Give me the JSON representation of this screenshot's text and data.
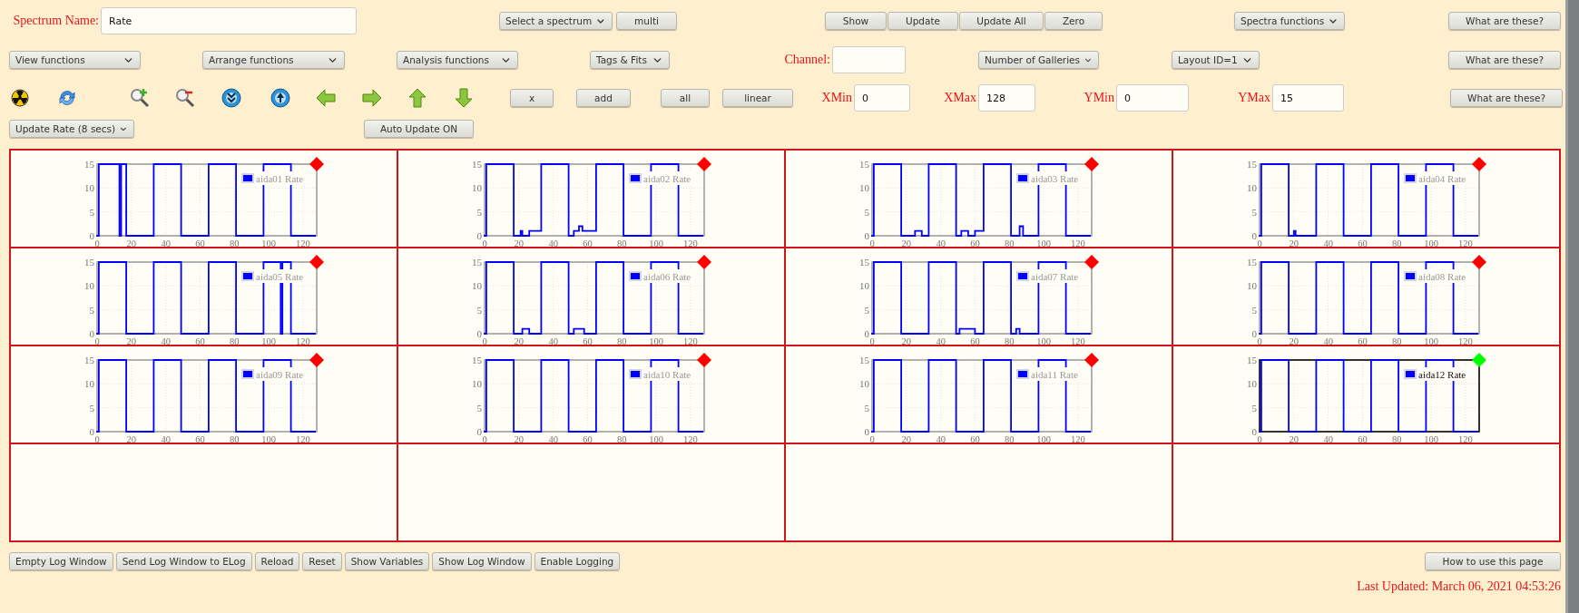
{
  "toolbar_rows": [
    {
      "items": [
        {
          "kind": "field",
          "label": "Spectrum Name:",
          "value": "Rate"
        },
        {
          "kind": "dropdown",
          "label": "Select a spectrum"
        },
        {
          "kind": "button",
          "label": "multi"
        },
        {
          "kind": "button",
          "label": "Show"
        },
        {
          "kind": "button",
          "label": "Update"
        },
        {
          "kind": "button",
          "label": "Update All"
        },
        {
          "kind": "button",
          "label": "Zero"
        },
        {
          "kind": "dropdown",
          "label": "Spectra functions"
        },
        {
          "kind": "button",
          "label": "What are these?"
        }
      ]
    },
    {
      "items": [
        {
          "kind": "dropdown",
          "label": "View functions"
        },
        {
          "kind": "dropdown",
          "label": "Arrange functions"
        },
        {
          "kind": "dropdown",
          "label": "Analysis functions"
        },
        {
          "kind": "dropdown",
          "label": "Tags & Fits"
        },
        {
          "kind": "field",
          "label": "Channel:"
        },
        {
          "kind": "dropdown",
          "label": "Number of Galleries"
        },
        {
          "kind": "dropdown",
          "label": "Layout ID=1"
        },
        {
          "kind": "button",
          "label": "What are these?"
        }
      ]
    },
    {
      "items": [
        {
          "kind": "button",
          "label": "x"
        },
        {
          "kind": "button",
          "label": "add"
        },
        {
          "kind": "button",
          "label": "all"
        },
        {
          "kind": "button",
          "label": "linear"
        },
        {
          "kind": "field",
          "label": "XMin",
          "value": "0"
        },
        {
          "kind": "field",
          "label": "XMax",
          "value": "128"
        },
        {
          "kind": "field",
          "label": "YMin",
          "value": "0"
        },
        {
          "kind": "field",
          "label": "YMax",
          "value": "15"
        },
        {
          "kind": "button",
          "label": "What are these?"
        }
      ]
    },
    {
      "items": [
        {
          "kind": "dropdown",
          "label": "Update Rate (8 secs)"
        },
        {
          "kind": "button",
          "label": "Auto Update ON"
        }
      ]
    }
  ],
  "gallery": {
    "cells": [
      {
        "kind": "chart",
        "selected": false,
        "color": "#ff0000",
        "chart_data": {
          "type": "line",
          "grid": true,
          "x": [
            0,
            1,
            1,
            13,
            13,
            14,
            14,
            17,
            17,
            33,
            33,
            49,
            49,
            65,
            65,
            81,
            81,
            97,
            97,
            113,
            113,
            127
          ],
          "xlim": [
            0,
            128
          ],
          "ylim": [
            0,
            15
          ],
          "xticks": [
            0,
            20,
            40,
            60,
            80,
            100,
            120
          ],
          "yticks": [
            0,
            5,
            10,
            15
          ],
          "series": [
            {
              "name": "aida01 Rate",
              "color": "#0000ff",
              "values": [
                0,
                0,
                15,
                15,
                0,
                0,
                15,
                15,
                0,
                0,
                15,
                15,
                0,
                0,
                15,
                15,
                0,
                0,
                15,
                15,
                0,
                0
              ]
            }
          ]
        }
      },
      {
        "kind": "chart",
        "selected": false,
        "color": "#ff0000",
        "chart_data": {
          "type": "line",
          "grid": true,
          "x": [
            0,
            1,
            1,
            17,
            17,
            21,
            21,
            22,
            22,
            26,
            26,
            33,
            33,
            49,
            49,
            52,
            52,
            55,
            55,
            57,
            57,
            65,
            65,
            81,
            81,
            97,
            97,
            113,
            113,
            127
          ],
          "xlim": [
            0,
            128
          ],
          "ylim": [
            0,
            15
          ],
          "xticks": [
            0,
            20,
            40,
            60,
            80,
            100,
            120
          ],
          "yticks": [
            0,
            5,
            10,
            15
          ],
          "series": [
            {
              "name": "aida02 Rate",
              "color": "#0000ff",
              "values": [
                0,
                0,
                15,
                15,
                0,
                0,
                1,
                1,
                0,
                0,
                1,
                1,
                15,
                15,
                0,
                0,
                1,
                1,
                2,
                2,
                1,
                1,
                15,
                15,
                0,
                0,
                15,
                15,
                0,
                0
              ]
            }
          ]
        }
      },
      {
        "kind": "chart",
        "selected": false,
        "color": "#ff0000",
        "chart_data": {
          "type": "line",
          "grid": true,
          "x": [
            0,
            1,
            1,
            17,
            17,
            25,
            25,
            29,
            29,
            33,
            33,
            49,
            49,
            52,
            52,
            56,
            56,
            60,
            60,
            65,
            65,
            81,
            81,
            86,
            86,
            88,
            88,
            97,
            97,
            113,
            113,
            127
          ],
          "xlim": [
            0,
            128
          ],
          "ylim": [
            0,
            15
          ],
          "xticks": [
            0,
            20,
            40,
            60,
            80,
            100,
            120
          ],
          "yticks": [
            0,
            5,
            10,
            15
          ],
          "series": [
            {
              "name": "aida03 Rate",
              "color": "#0000ff",
              "values": [
                0,
                0,
                15,
                15,
                0,
                0,
                1,
                1,
                0,
                0,
                15,
                15,
                0,
                0,
                1,
                1,
                0,
                0,
                1,
                1,
                15,
                15,
                0,
                0,
                2,
                2,
                0,
                0,
                15,
                15,
                0,
                0
              ]
            }
          ]
        }
      },
      {
        "kind": "chart",
        "selected": false,
        "color": "#ff0000",
        "chart_data": {
          "type": "line",
          "grid": true,
          "x": [
            0,
            1,
            1,
            17,
            17,
            20,
            20,
            21,
            21,
            33,
            33,
            49,
            49,
            65,
            65,
            81,
            81,
            97,
            97,
            113,
            113,
            127
          ],
          "xlim": [
            0,
            128
          ],
          "ylim": [
            0,
            15
          ],
          "xticks": [
            0,
            20,
            40,
            60,
            80,
            100,
            120
          ],
          "yticks": [
            0,
            5,
            10,
            15
          ],
          "series": [
            {
              "name": "aida04 Rate",
              "color": "#0000ff",
              "values": [
                0,
                0,
                15,
                15,
                0,
                0,
                1,
                1,
                0,
                0,
                15,
                15,
                0,
                0,
                15,
                15,
                0,
                0,
                15,
                15,
                0,
                0
              ]
            }
          ]
        }
      },
      {
        "kind": "chart",
        "selected": false,
        "color": "#ff0000",
        "chart_data": {
          "type": "line",
          "grid": true,
          "x": [
            0,
            1,
            1,
            17,
            17,
            33,
            33,
            49,
            49,
            65,
            65,
            81,
            81,
            97,
            97,
            107,
            107,
            108,
            108,
            113,
            113,
            127
          ],
          "xlim": [
            0,
            128
          ],
          "ylim": [
            0,
            15
          ],
          "xticks": [
            0,
            20,
            40,
            60,
            80,
            100,
            120
          ],
          "yticks": [
            0,
            5,
            10,
            15
          ],
          "series": [
            {
              "name": "aida05 Rate",
              "color": "#0000ff",
              "values": [
                0,
                0,
                15,
                15,
                0,
                0,
                15,
                15,
                0,
                0,
                15,
                15,
                0,
                0,
                15,
                15,
                0,
                0,
                15,
                15,
                0,
                0
              ]
            }
          ]
        }
      },
      {
        "kind": "chart",
        "selected": false,
        "color": "#ff0000",
        "chart_data": {
          "type": "line",
          "grid": true,
          "x": [
            0,
            1,
            1,
            17,
            17,
            22,
            22,
            26,
            26,
            33,
            33,
            49,
            49,
            52,
            52,
            58,
            58,
            65,
            65,
            81,
            81,
            97,
            97,
            113,
            113,
            127
          ],
          "xlim": [
            0,
            128
          ],
          "ylim": [
            0,
            15
          ],
          "xticks": [
            0,
            20,
            40,
            60,
            80,
            100,
            120
          ],
          "yticks": [
            0,
            5,
            10,
            15
          ],
          "series": [
            {
              "name": "aida06 Rate",
              "color": "#0000ff",
              "values": [
                0,
                0,
                15,
                15,
                0,
                0,
                1,
                1,
                0,
                0,
                15,
                15,
                0,
                0,
                1,
                1,
                0,
                0,
                15,
                15,
                0,
                0,
                15,
                15,
                0,
                0
              ]
            }
          ]
        }
      },
      {
        "kind": "chart",
        "selected": false,
        "color": "#ff0000",
        "chart_data": {
          "type": "line",
          "grid": true,
          "x": [
            0,
            1,
            1,
            17,
            17,
            33,
            33,
            49,
            49,
            51,
            51,
            60,
            60,
            65,
            65,
            81,
            81,
            84,
            84,
            86,
            86,
            97,
            97,
            113,
            113,
            127
          ],
          "xlim": [
            0,
            128
          ],
          "ylim": [
            0,
            15
          ],
          "xticks": [
            0,
            20,
            40,
            60,
            80,
            100,
            120
          ],
          "yticks": [
            0,
            5,
            10,
            15
          ],
          "series": [
            {
              "name": "aida07 Rate",
              "color": "#0000ff",
              "values": [
                0,
                0,
                15,
                15,
                0,
                0,
                15,
                15,
                0,
                0,
                1,
                1,
                0,
                0,
                15,
                15,
                0,
                0,
                1,
                1,
                0,
                0,
                15,
                15,
                0,
                0
              ]
            }
          ]
        }
      },
      {
        "kind": "chart",
        "selected": false,
        "color": "#ff0000",
        "chart_data": {
          "type": "line",
          "grid": true,
          "x": [
            0,
            1,
            1,
            17,
            17,
            33,
            33,
            49,
            49,
            65,
            65,
            81,
            81,
            97,
            97,
            113,
            113,
            127
          ],
          "xlim": [
            0,
            128
          ],
          "ylim": [
            0,
            15
          ],
          "xticks": [
            0,
            20,
            40,
            60,
            80,
            100,
            120
          ],
          "yticks": [
            0,
            5,
            10,
            15
          ],
          "series": [
            {
              "name": "aida08 Rate",
              "color": "#0000ff",
              "values": [
                0,
                0,
                15,
                15,
                0,
                0,
                15,
                15,
                0,
                0,
                15,
                15,
                0,
                0,
                15,
                15,
                0,
                0
              ]
            }
          ]
        }
      },
      {
        "kind": "chart",
        "selected": false,
        "color": "#ff0000",
        "chart_data": {
          "type": "line",
          "grid": true,
          "x": [
            0,
            1,
            1,
            17,
            17,
            33,
            33,
            49,
            49,
            65,
            65,
            81,
            81,
            97,
            97,
            113,
            113,
            127
          ],
          "xlim": [
            0,
            128
          ],
          "ylim": [
            0,
            15
          ],
          "xticks": [
            0,
            20,
            40,
            60,
            80,
            100,
            120
          ],
          "yticks": [
            0,
            5,
            10,
            15
          ],
          "series": [
            {
              "name": "aida09 Rate",
              "color": "#0000ff",
              "values": [
                0,
                0,
                15,
                15,
                0,
                0,
                15,
                15,
                0,
                0,
                15,
                15,
                0,
                0,
                15,
                15,
                0,
                0
              ]
            }
          ]
        }
      },
      {
        "kind": "chart",
        "selected": false,
        "color": "#ff0000",
        "chart_data": {
          "type": "line",
          "grid": true,
          "x": [
            0,
            1,
            1,
            17,
            17,
            33,
            33,
            49,
            49,
            65,
            65,
            81,
            81,
            97,
            97,
            113,
            113,
            127
          ],
          "xlim": [
            0,
            128
          ],
          "ylim": [
            0,
            15
          ],
          "xticks": [
            0,
            20,
            40,
            60,
            80,
            100,
            120
          ],
          "yticks": [
            0,
            5,
            10,
            15
          ],
          "series": [
            {
              "name": "aida10 Rate",
              "color": "#0000ff",
              "values": [
                0,
                0,
                15,
                15,
                0,
                0,
                15,
                15,
                0,
                0,
                15,
                15,
                0,
                0,
                15,
                15,
                0,
                0
              ]
            }
          ]
        }
      },
      {
        "kind": "chart",
        "selected": false,
        "color": "#ff0000",
        "chart_data": {
          "type": "line",
          "grid": true,
          "x": [
            0,
            1,
            1,
            17,
            17,
            33,
            33,
            49,
            49,
            65,
            65,
            81,
            81,
            97,
            97,
            113,
            113,
            127
          ],
          "xlim": [
            0,
            128
          ],
          "ylim": [
            0,
            15
          ],
          "xticks": [
            0,
            20,
            40,
            60,
            80,
            100,
            120
          ],
          "yticks": [
            0,
            5,
            10,
            15
          ],
          "series": [
            {
              "name": "aida11 Rate",
              "color": "#0000ff",
              "values": [
                0,
                0,
                15,
                15,
                0,
                0,
                15,
                15,
                0,
                0,
                15,
                15,
                0,
                0,
                15,
                15,
                0,
                0
              ]
            }
          ]
        }
      },
      {
        "kind": "chart",
        "selected": true,
        "color": "#00ff00",
        "chart_data": {
          "type": "line",
          "grid": true,
          "x": [
            0,
            1,
            1,
            17,
            17,
            33,
            33,
            49,
            49,
            65,
            65,
            81,
            81,
            97,
            97,
            113,
            113,
            127
          ],
          "xlim": [
            0,
            128
          ],
          "ylim": [
            0,
            15
          ],
          "xticks": [
            0,
            20,
            40,
            60,
            80,
            100,
            120
          ],
          "yticks": [
            0,
            5,
            10,
            15
          ],
          "series": [
            {
              "name": "aida12 Rate",
              "color": "#0000ff",
              "values": [
                0,
                0,
                15,
                15,
                0,
                0,
                15,
                15,
                0,
                0,
                15,
                15,
                0,
                0,
                15,
                15,
                0,
                0
              ]
            }
          ]
        }
      },
      {
        "kind": "empty"
      },
      {
        "kind": "empty"
      },
      {
        "kind": "empty"
      },
      {
        "kind": "empty"
      }
    ]
  },
  "bottom_buttons": [
    "Empty Log Window",
    "Send Log Window to ELog",
    "Reload",
    "Reset",
    "Show Variables",
    "Show Log Window",
    "Enable Logging"
  ],
  "help_button": "How to use this page",
  "last_updated": "Last Updated: March 06, 2021 04:53:26"
}
